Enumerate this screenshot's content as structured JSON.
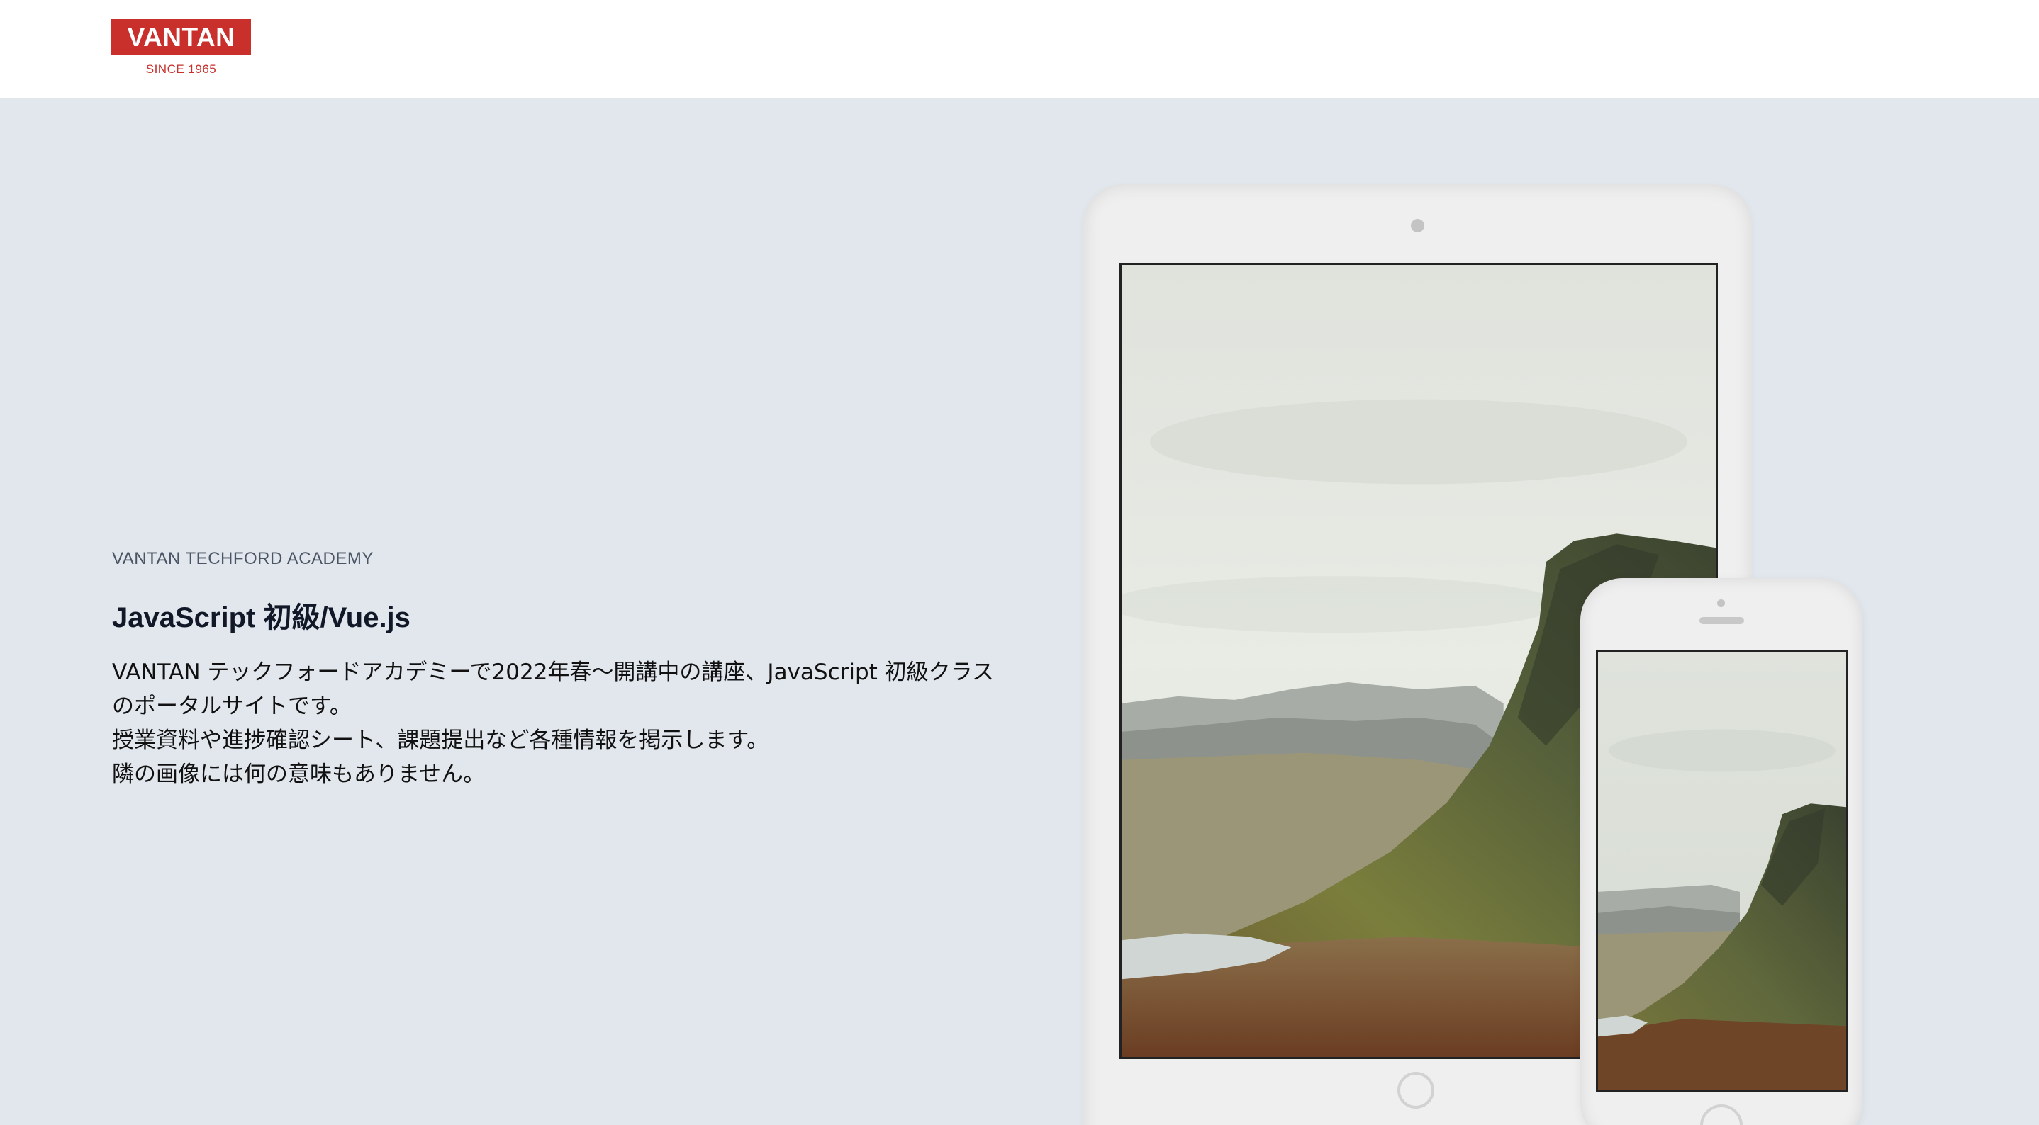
{
  "header": {
    "logo": {
      "brand": "VANTAN",
      "tagline": "SINCE 1965",
      "color": "#c9302c"
    }
  },
  "hero": {
    "eyebrow": "VANTAN TECHFORD ACADEMY",
    "title": "JavaScript 初級/Vue.js",
    "description": [
      "VANTAN テックフォードアカデミーで2022年春〜開講中の講座、JavaScript 初級クラス",
      "のポータルサイトです。",
      "授業資料や進捗確認シート、課題提出など各種情報を掲示します。",
      "隣の画像には何の意味もありません。"
    ],
    "background": "#e2e7ee"
  },
  "devices": {
    "tablet_image": "mountain-landscape-image",
    "phone_image": "mountain-landscape-image"
  }
}
